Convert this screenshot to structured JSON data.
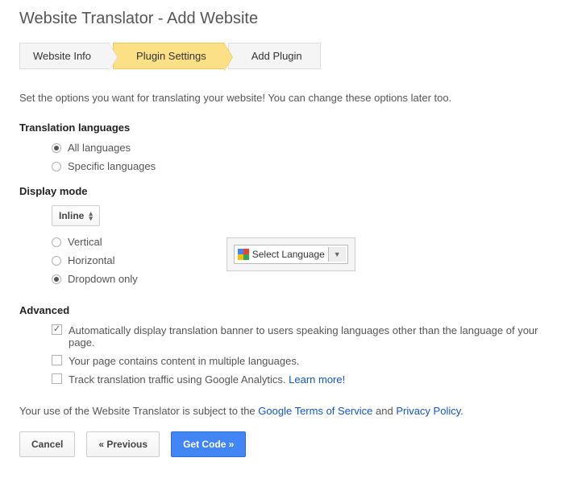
{
  "title": "Website Translator - Add Website",
  "wizard": {
    "steps": [
      "Website Info",
      "Plugin Settings",
      "Add Plugin"
    ],
    "active_index": 1
  },
  "intro": "Set the options you want for translating your website! You can change these options later too.",
  "sections": {
    "languages": {
      "title": "Translation languages",
      "options": [
        {
          "label": "All languages",
          "checked": true
        },
        {
          "label": "Specific languages",
          "checked": false
        }
      ]
    },
    "display": {
      "title": "Display mode",
      "select_value": "Inline",
      "options": [
        {
          "label": "Vertical",
          "checked": false
        },
        {
          "label": "Horizontal",
          "checked": false
        },
        {
          "label": "Dropdown only",
          "checked": true
        }
      ],
      "gadget_label": "Select Language"
    },
    "advanced": {
      "title": "Advanced",
      "options": [
        {
          "label": "Automatically display translation banner to users speaking languages other than the language of your page.",
          "checked": true
        },
        {
          "label": "Your page contains content in multiple languages.",
          "checked": false
        },
        {
          "label": "Track translation traffic using Google Analytics.",
          "checked": false,
          "link_label": "Learn more!"
        }
      ]
    }
  },
  "footer": {
    "prefix": "Your use of the Website Translator is subject to the ",
    "tos": "Google Terms of Service",
    "and": " and ",
    "privacy": "Privacy Policy",
    "suffix": "."
  },
  "buttons": {
    "cancel": "Cancel",
    "previous": "« Previous",
    "getcode": "Get Code »"
  }
}
